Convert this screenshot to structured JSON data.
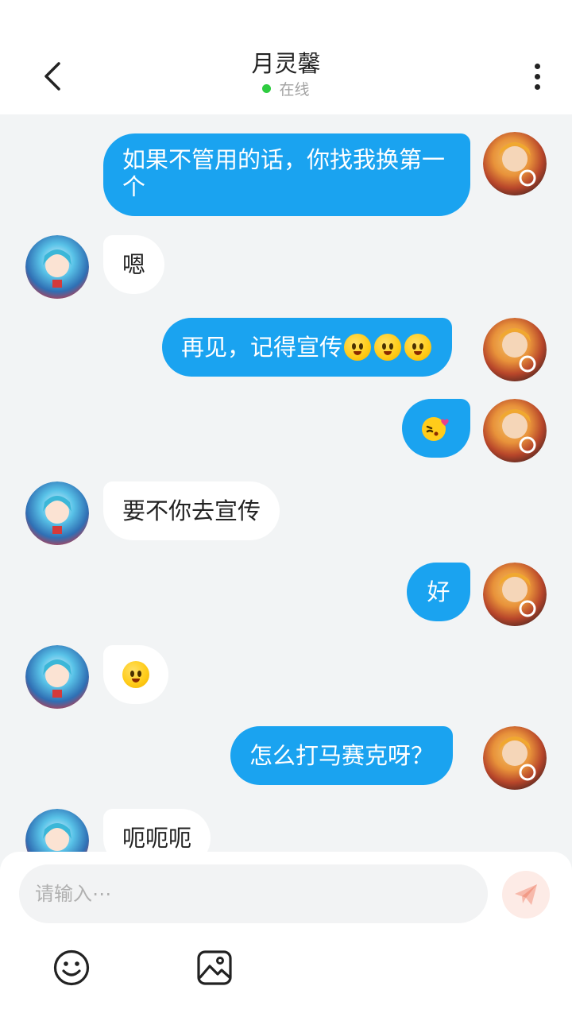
{
  "header": {
    "title": "月灵馨",
    "status_text": "在线",
    "status_color": "#2ecc40"
  },
  "colors": {
    "my_bubble": "#1aa3f0",
    "their_bubble": "#ffffff",
    "background": "#f2f4f5"
  },
  "messages": [
    {
      "sender": "me",
      "text": "如果不管用的话，你找我换第一个"
    },
    {
      "sender": "other",
      "text": "嗯"
    },
    {
      "sender": "me",
      "text": "再见，记得宣传",
      "emoji": "grinning-face-emoji x3"
    },
    {
      "sender": "me",
      "text": "",
      "emoji": "kissing-heart-emoji"
    },
    {
      "sender": "other",
      "text": "要不你去宣传"
    },
    {
      "sender": "me",
      "text": "好"
    },
    {
      "sender": "other",
      "text": "",
      "emoji": "grinning-face-emoji"
    },
    {
      "sender": "me",
      "text": "怎么打马赛克呀？"
    },
    {
      "sender": "other",
      "text": "呃呃呃"
    }
  ],
  "input": {
    "placeholder": "请输入⋯",
    "send_icon": "paper-plane-icon",
    "tools": [
      "smiley-icon",
      "image-icon"
    ]
  }
}
